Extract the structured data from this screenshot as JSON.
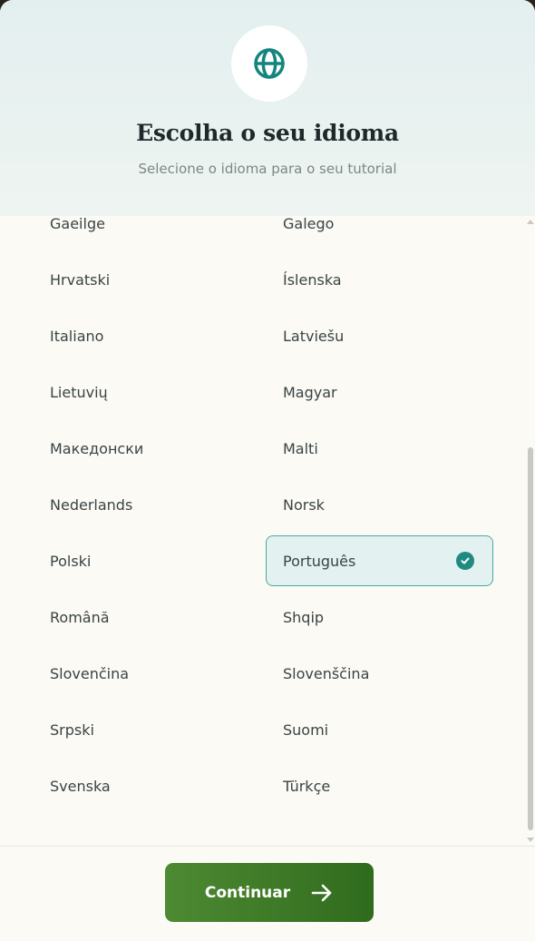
{
  "header": {
    "icon": "globe-icon",
    "title": "Escolha o seu idioma",
    "subtitle": "Selecione o idioma para o seu tutorial"
  },
  "languages": {
    "rows": [
      [
        "Gaeilge",
        "Galego"
      ],
      [
        "Hrvatski",
        "Íslenska"
      ],
      [
        "Italiano",
        "Latviešu"
      ],
      [
        "Lietuvių",
        "Magyar"
      ],
      [
        "Македонски",
        "Malti"
      ],
      [
        "Nederlands",
        "Norsk"
      ],
      [
        "Polski",
        "Português"
      ],
      [
        "Română",
        "Shqip"
      ],
      [
        "Slovenčina",
        "Slovenščina"
      ],
      [
        "Srpski",
        "Suomi"
      ],
      [
        "Svenska",
        "Türkçe"
      ]
    ],
    "selected": "Português"
  },
  "footer": {
    "continue_label": "Continuar",
    "continue_icon": "arrow-right-icon"
  },
  "colors": {
    "accent_teal": "#1e8a82",
    "button_green": "#3d7a26",
    "header_bg": "#e3efef"
  }
}
